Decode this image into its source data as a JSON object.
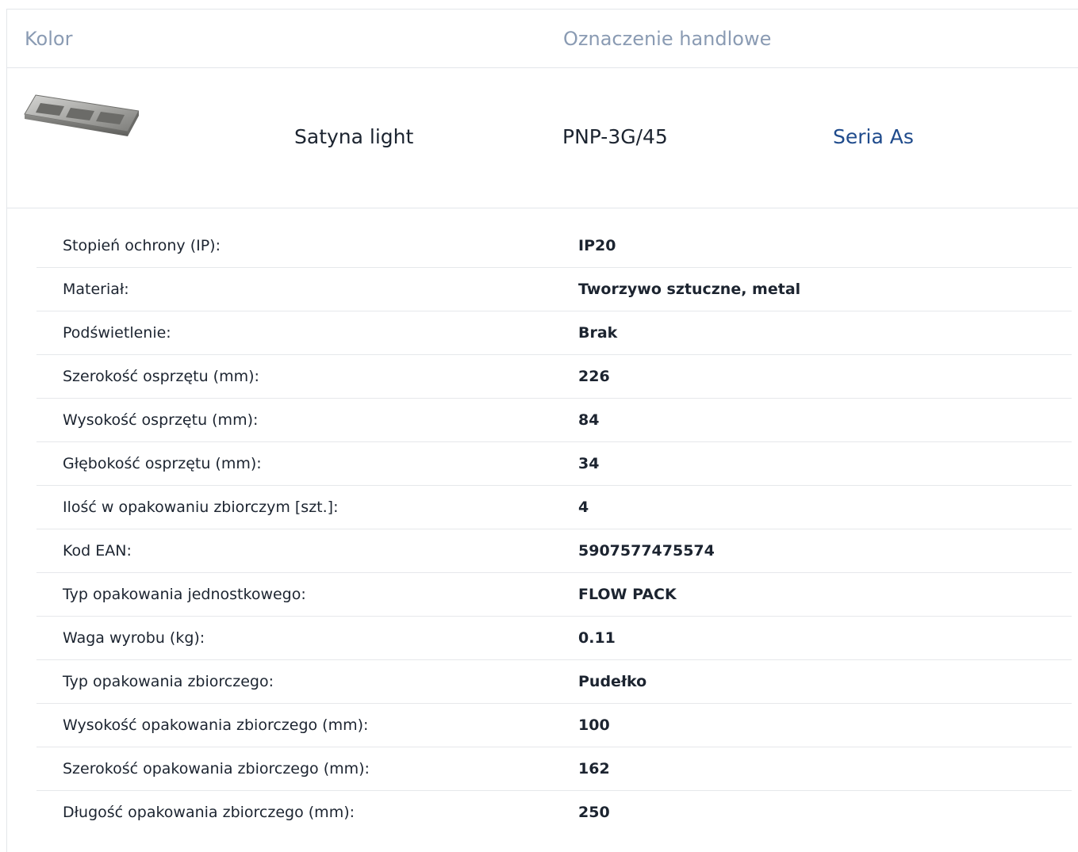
{
  "header": {
    "color_label": "Kolor",
    "trade_label": "Oznaczenie handlowe"
  },
  "product": {
    "image_icon": "metal-frame-3g-image",
    "color": "Satyna light",
    "code": "PNP-3G/45",
    "series_link": "Seria As"
  },
  "specs": [
    {
      "label": "Stopień ochrony (IP):",
      "value": "IP20"
    },
    {
      "label": "Materiał:",
      "value": "Tworzywo sztuczne, metal"
    },
    {
      "label": "Podświetlenie:",
      "value": "Brak"
    },
    {
      "label": "Szerokość osprzętu (mm):",
      "value": "226"
    },
    {
      "label": "Wysokość osprzętu (mm):",
      "value": "84"
    },
    {
      "label": "Głębokość osprzętu (mm):",
      "value": "34"
    },
    {
      "label": "Ilość w opakowaniu zbiorczym [szt.]:",
      "value": "4"
    },
    {
      "label": "Kod EAN:",
      "value": "5907577475574"
    },
    {
      "label": "Typ opakowania jednostkowego:",
      "value": "FLOW PACK"
    },
    {
      "label": "Waga wyrobu (kg):",
      "value": "0.11"
    },
    {
      "label": "Typ opakowania zbiorczego:",
      "value": "Pudełko"
    },
    {
      "label": "Wysokość opakowania zbiorczego (mm):",
      "value": "100"
    },
    {
      "label": "Szerokość opakowania zbiorczego (mm):",
      "value": "162"
    },
    {
      "label": "Długość opakowania zbiorczego (mm):",
      "value": "250"
    }
  ],
  "colors": {
    "header_text": "#8a9bb3",
    "link": "#1f4b8c",
    "text": "#1c2430",
    "divider": "#e3e6ea"
  }
}
